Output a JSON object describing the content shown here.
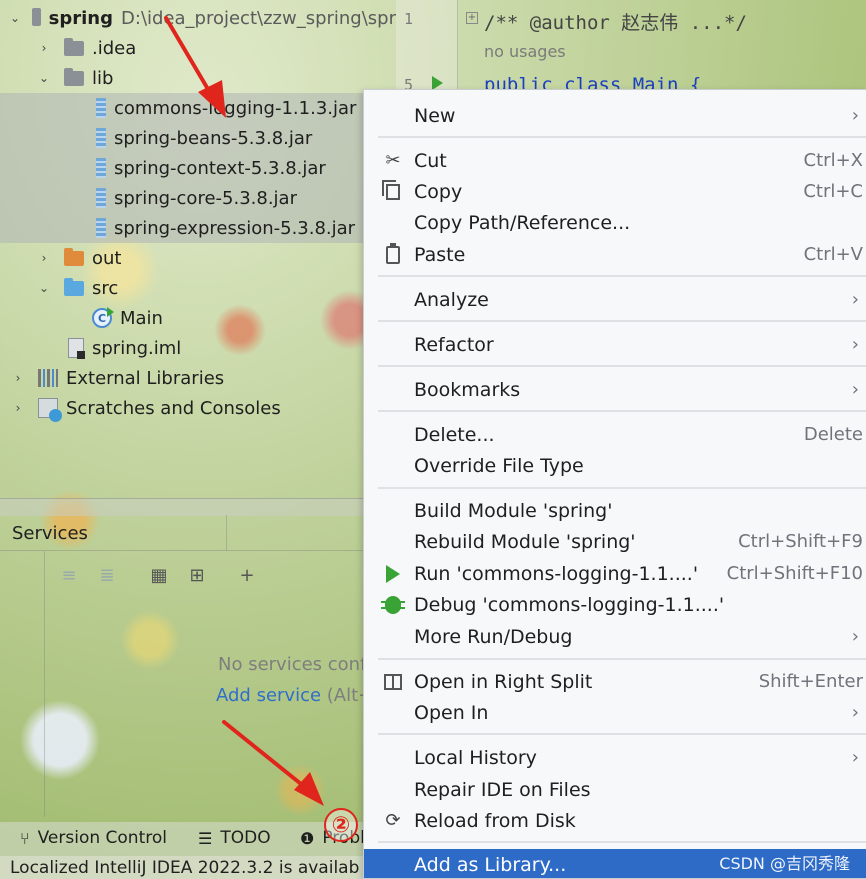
{
  "project_tree": {
    "root": {
      "name": "spring",
      "path": "D:\\idea_project\\zzw_spring\\spr"
    },
    "items": [
      {
        "label": ".idea",
        "kind": "folder"
      },
      {
        "label": "lib",
        "kind": "folder"
      },
      {
        "label": "commons-logging-1.1.3.jar",
        "kind": "jar"
      },
      {
        "label": "spring-beans-5.3.8.jar",
        "kind": "jar"
      },
      {
        "label": "spring-context-5.3.8.jar",
        "kind": "jar"
      },
      {
        "label": "spring-core-5.3.8.jar",
        "kind": "jar"
      },
      {
        "label": "spring-expression-5.3.8.jar",
        "kind": "jar"
      },
      {
        "label": "out",
        "kind": "folder"
      },
      {
        "label": "src",
        "kind": "folder"
      },
      {
        "label": "Main",
        "kind": "class"
      },
      {
        "label": "spring.iml",
        "kind": "file"
      },
      {
        "label": "External Libraries",
        "kind": "library"
      },
      {
        "label": "Scratches and Consoles",
        "kind": "scratch"
      }
    ]
  },
  "editor": {
    "line_numbers": [
      "1",
      "5"
    ],
    "comment_line": "/** @author 赵志伟 ...*/",
    "usage_hint": "no usages",
    "code_line": "public class Main {"
  },
  "services": {
    "title": "Services",
    "empty_text": "No services confi",
    "add_service": "Add service",
    "add_shortcut": "(Alt+"
  },
  "bottom_bar": {
    "tabs": [
      {
        "label": "Version Control",
        "icon": "branch-icon"
      },
      {
        "label": "TODO",
        "icon": "list-icon"
      },
      {
        "label": "Probl",
        "icon": "problems-icon"
      }
    ],
    "status": "Localized IntelliJ IDEA 2022.3.2 is availab"
  },
  "annotation": {
    "step": "②"
  },
  "context_menu": {
    "items": [
      {
        "label": "New",
        "shortcut": "",
        "submenu": true,
        "icon": ""
      },
      {
        "label": "Cut",
        "shortcut": "Ctrl+X",
        "submenu": false,
        "icon": "scissors-icon"
      },
      {
        "label": "Copy",
        "shortcut": "Ctrl+C",
        "submenu": false,
        "icon": "copy-icon"
      },
      {
        "label": "Copy Path/Reference...",
        "shortcut": "",
        "submenu": false,
        "icon": ""
      },
      {
        "label": "Paste",
        "shortcut": "Ctrl+V",
        "submenu": false,
        "icon": "paste-icon"
      },
      {
        "label": "Analyze",
        "shortcut": "",
        "submenu": true,
        "icon": ""
      },
      {
        "label": "Refactor",
        "shortcut": "",
        "submenu": true,
        "icon": ""
      },
      {
        "label": "Bookmarks",
        "shortcut": "",
        "submenu": true,
        "icon": ""
      },
      {
        "label": "Delete...",
        "shortcut": "Delete",
        "submenu": false,
        "icon": ""
      },
      {
        "label": "Override File Type",
        "shortcut": "",
        "submenu": false,
        "icon": ""
      },
      {
        "label": "Build Module 'spring'",
        "shortcut": "",
        "submenu": false,
        "icon": ""
      },
      {
        "label": "Rebuild Module 'spring'",
        "shortcut": "Ctrl+Shift+F9",
        "submenu": false,
        "icon": ""
      },
      {
        "label": "Run 'commons-logging-1.1....'",
        "shortcut": "Ctrl+Shift+F10",
        "submenu": false,
        "icon": "run-icon"
      },
      {
        "label": "Debug 'commons-logging-1.1....'",
        "shortcut": "",
        "submenu": false,
        "icon": "debug-icon"
      },
      {
        "label": "More Run/Debug",
        "shortcut": "",
        "submenu": true,
        "icon": ""
      },
      {
        "label": "Open in Right Split",
        "shortcut": "Shift+Enter",
        "submenu": false,
        "icon": "split-icon"
      },
      {
        "label": "Open In",
        "shortcut": "",
        "submenu": true,
        "icon": ""
      },
      {
        "label": "Local History",
        "shortcut": "",
        "submenu": true,
        "icon": ""
      },
      {
        "label": "Repair IDE on Files",
        "shortcut": "",
        "submenu": false,
        "icon": ""
      },
      {
        "label": "Reload from Disk",
        "shortcut": "",
        "submenu": false,
        "icon": "reload-icon"
      },
      {
        "label": "Add as Library...",
        "shortcut": "",
        "submenu": false,
        "icon": ""
      }
    ]
  },
  "watermark": "CSDN @吉冈秀隆",
  "colors": {
    "menu_highlight": "#2d6bc7",
    "annotation_red": "#e0261c",
    "link_blue": "#2f6fc9"
  }
}
